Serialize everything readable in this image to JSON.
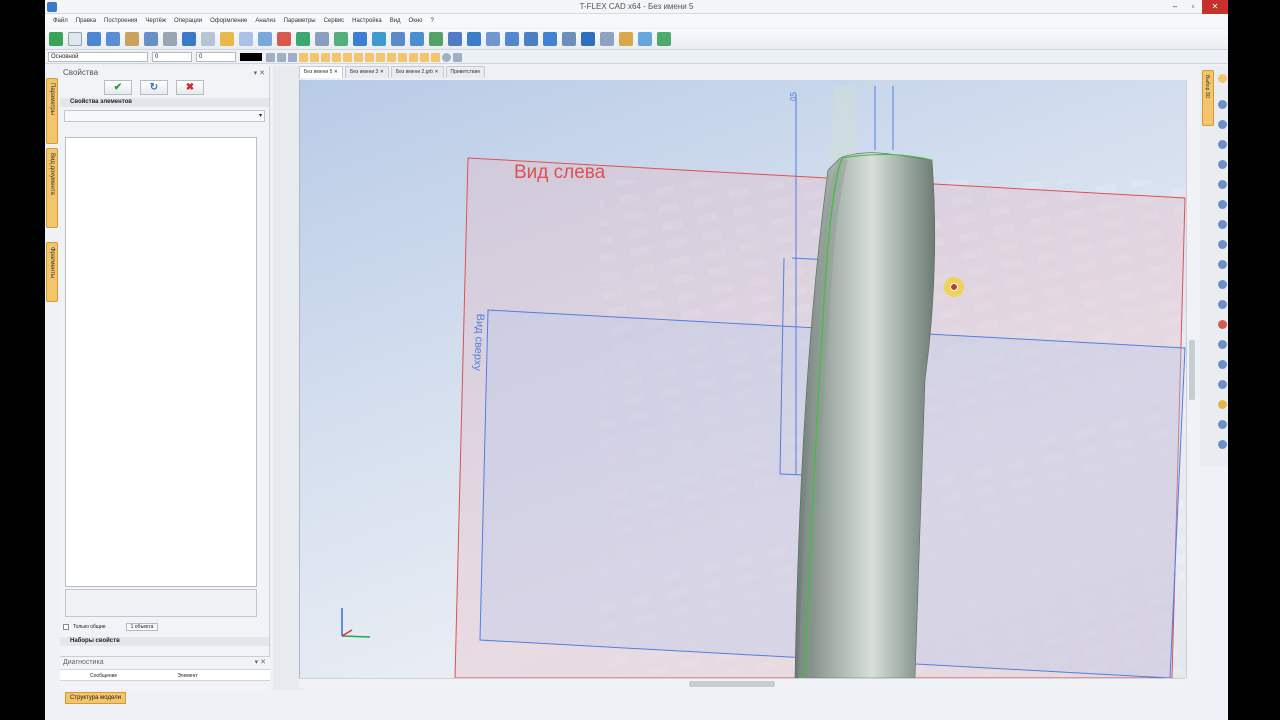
{
  "window": {
    "title": "T-FLEX CAD x64 - Без имени 5"
  },
  "menu": [
    "Файл",
    "Правка",
    "Построения",
    "Чертёж",
    "Операции",
    "Оформление",
    "Анализ",
    "Параметры",
    "Сервис",
    "Настройка",
    "Вид",
    "Окно",
    "?"
  ],
  "toolbar2": {
    "layer": "Основной",
    "value1": "0",
    "value2": "0"
  },
  "properties_panel": {
    "title": "Свойства",
    "ok_glyph": "✔",
    "apply_glyph": "↻",
    "cancel_glyph": "✖",
    "section_elements": "Свойства элементов",
    "only_common": "Только общие",
    "objects_count": "1 объекта",
    "section_sets": "Наборы свойств"
  },
  "side_tabs": [
    "Параметры",
    "Вид документа",
    "Фрагменты"
  ],
  "diagnostics": {
    "title": "Диагностика",
    "col_message": "Сообщение",
    "col_element": "Элемент"
  },
  "bottom_tab": "Структура модели",
  "doc_tabs": [
    "Без имени 5",
    "Без имени 3",
    "Без имени 2.grb",
    "Приветствие"
  ],
  "viewport": {
    "plane_left_label": "Вид слева",
    "plane_front_label": "Вид сверху",
    "dim_label": "50"
  },
  "right_tab": "Выбор 3D",
  "colors": {
    "accent_orange": "#f4c56b",
    "plane_red": "#e05050",
    "plane_blue": "#4f7fe0",
    "edge_green": "#3fbf3f"
  }
}
